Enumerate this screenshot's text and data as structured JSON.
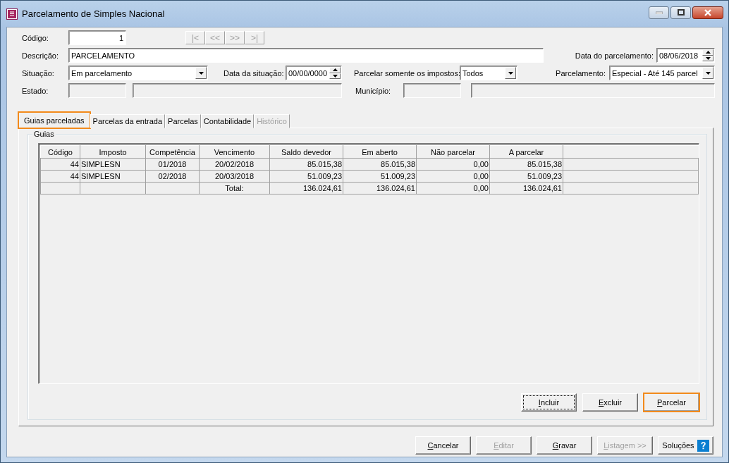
{
  "window": {
    "title": "Parcelamento de Simples Nacional"
  },
  "form": {
    "codigo": {
      "label": "Código:",
      "value": "1"
    },
    "nav_buttons": [
      {
        "text": "|<",
        "disabled": true
      },
      {
        "text": "<<",
        "disabled": true
      },
      {
        "text": ">>",
        "disabled": true
      },
      {
        "text": ">|",
        "disabled": true
      }
    ],
    "descricao": {
      "label": "Descrição:",
      "value": "PARCELAMENTO"
    },
    "data_parcelamento": {
      "label": "Data do parcelamento:",
      "value": "08/06/2018"
    },
    "situacao": {
      "label": "Situação:",
      "value": "Em parcelamento"
    },
    "data_situacao": {
      "label": "Data da situação:",
      "value": "00/00/0000"
    },
    "parcelar_impostos": {
      "label": "Parcelar somente os impostos:",
      "value": "Todos"
    },
    "parcelamento": {
      "label": "Parcelamento:",
      "value": "Especial - Até 145 parcel"
    },
    "estado": {
      "label": "Estado:"
    },
    "municipio": {
      "label": "Município:"
    }
  },
  "tabs": [
    {
      "label": "Guias parceladas",
      "selected": true,
      "disabled": false,
      "highlighted": true
    },
    {
      "label": "Parcelas da entrada",
      "selected": false,
      "disabled": false,
      "highlighted": false
    },
    {
      "label": "Parcelas",
      "selected": false,
      "disabled": false,
      "highlighted": false
    },
    {
      "label": "Contabilidade",
      "selected": false,
      "disabled": false,
      "highlighted": false
    },
    {
      "label": "Histórico",
      "selected": false,
      "disabled": true,
      "highlighted": false
    }
  ],
  "group": {
    "title": "Guias"
  },
  "table": {
    "columns": [
      "Código",
      "Imposto",
      "Competência",
      "Vencimento",
      "Saldo devedor",
      "Em aberto",
      "Não parcelar",
      "A parcelar"
    ],
    "rows": [
      [
        "44",
        "SIMPLESN",
        "01/2018",
        "20/02/2018",
        "85.015,38",
        "85.015,38",
        "0,00",
        "85.015,38"
      ],
      [
        "44",
        "SIMPLESN",
        "02/2018",
        "20/03/2018",
        "51.009,23",
        "51.009,23",
        "0,00",
        "51.009,23"
      ],
      [
        "",
        "",
        "",
        "Total:",
        "136.024,61",
        "136.024,61",
        "0,00",
        "136.024,61"
      ]
    ]
  },
  "panel_buttons": [
    {
      "label": "Incluir",
      "focused": true,
      "highlighted": false,
      "disabled": false
    },
    {
      "label": "Excluir",
      "focused": false,
      "highlighted": false,
      "disabled": false
    },
    {
      "label": "Parcelar",
      "focused": false,
      "highlighted": true,
      "disabled": false
    }
  ],
  "footer_buttons": [
    {
      "kind": "plain",
      "label": "Cancelar",
      "disabled": false
    },
    {
      "kind": "plain",
      "label": "Editar",
      "disabled": true
    },
    {
      "kind": "plain",
      "label": "Gravar",
      "disabled": false
    },
    {
      "kind": "plain",
      "label": "Listagem >>",
      "disabled": true
    },
    {
      "kind": "help",
      "label": "Soluções",
      "disabled": false
    }
  ]
}
